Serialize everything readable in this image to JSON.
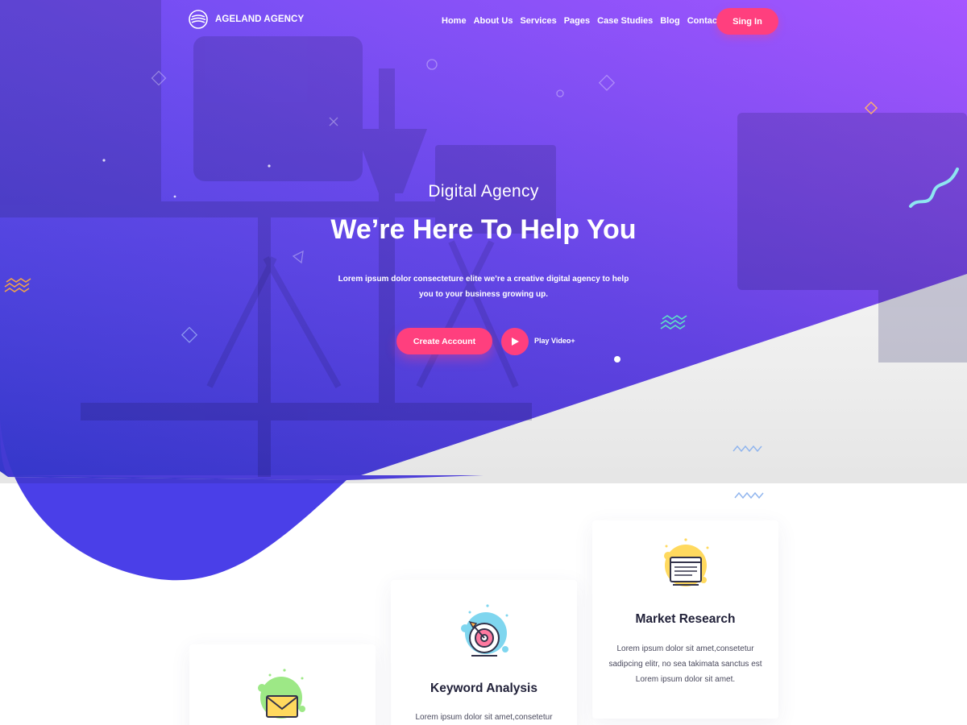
{
  "brand": {
    "name": "AGELAND AGENCY",
    "logo_icon": "concentric-wave-logo"
  },
  "nav": {
    "items": [
      "Home",
      "About Us",
      "Services",
      "Pages",
      "Case Studies",
      "Blog",
      "Contact"
    ],
    "signin_label": "Sing In"
  },
  "hero": {
    "kicker": "Digital Agency",
    "title": "We’re Here To Help You",
    "description": "Lorem ipsum dolor consecteture elite we’re a creative digital agency to help you to your business growing up.",
    "create_account_label": "Create Account",
    "play_video_label": "Play Video+",
    "play_icon": "play-icon"
  },
  "cards": [
    {
      "title": "Market Research",
      "text": "Lorem ipsum dolor sit amet,consetetur sadipcing elitr, no sea takimata sanctus est Lorem ipsum dolor sit amet.",
      "icon": "document-screen-icon",
      "blob_color": "#ffd95e"
    },
    {
      "title": "Keyword Analysis",
      "text": "Lorem ipsum dolor sit amet,consetetur",
      "icon": "target-arrow-icon",
      "blob_color": "#7fd6ef"
    },
    {
      "title": "",
      "text": "",
      "icon": "envelope-icon",
      "blob_color": "#9de886"
    }
  ],
  "colors": {
    "accent": "#ff3f7e",
    "gradient_start": "#3a3de0",
    "gradient_end": "#a04bff",
    "heading_text": "#22223a"
  }
}
